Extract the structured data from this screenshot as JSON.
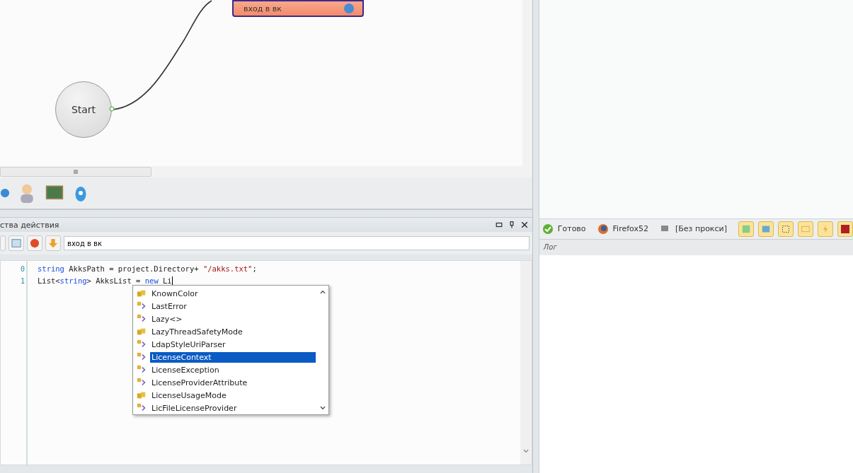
{
  "canvas": {
    "nodes": [
      {
        "kind": "action",
        "label": "вход в вк"
      },
      {
        "kind": "start",
        "label": "Start"
      }
    ]
  },
  "properties_panel": {
    "title": "ства действия",
    "action_name": "вход в вк"
  },
  "editor": {
    "lines": [
      {
        "number": "0",
        "tokens": [
          {
            "kind": "keyword",
            "text": "string"
          },
          {
            "kind": "plain",
            "text": " AkksPath = project.Directory+ "
          },
          {
            "kind": "string",
            "text": "\"/akks.txt\""
          },
          {
            "kind": "plain",
            "text": ";"
          }
        ]
      },
      {
        "number": "1",
        "tokens": [
          {
            "kind": "plain",
            "text": "List<"
          },
          {
            "kind": "keyword",
            "text": "string"
          },
          {
            "kind": "plain",
            "text": "> AkksList = "
          },
          {
            "kind": "keyword",
            "text": "new"
          },
          {
            "kind": "plain",
            "text": " Li"
          }
        ]
      }
    ]
  },
  "completion": {
    "items": [
      {
        "kind": "enum",
        "label": "KnownColor",
        "selected": false
      },
      {
        "kind": "class",
        "label": "LastError",
        "selected": false
      },
      {
        "kind": "class",
        "label": "Lazy<>",
        "selected": false
      },
      {
        "kind": "enum",
        "label": "LazyThreadSafetyMode",
        "selected": false
      },
      {
        "kind": "class",
        "label": "LdapStyleUriParser",
        "selected": false
      },
      {
        "kind": "class",
        "label": "LicenseContext",
        "selected": true
      },
      {
        "kind": "class",
        "label": "LicenseException",
        "selected": false
      },
      {
        "kind": "class",
        "label": "LicenseProviderAttribute",
        "selected": false
      },
      {
        "kind": "enum",
        "label": "LicenseUsageMode",
        "selected": false
      },
      {
        "kind": "class",
        "label": "LicFileLicenseProvider",
        "selected": false
      }
    ]
  },
  "status_bar": {
    "status": "Готово",
    "browser": "Firefox52",
    "proxy": "[Без прокси]"
  },
  "log": {
    "title": "Лог"
  }
}
